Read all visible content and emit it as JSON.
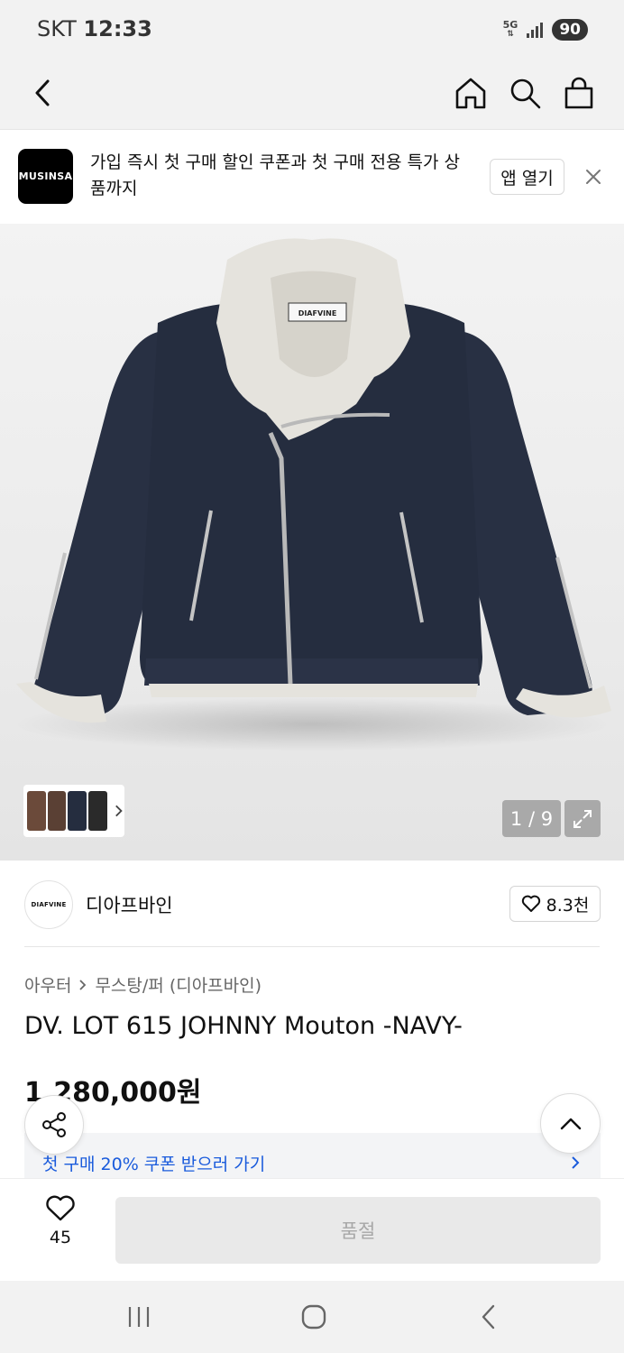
{
  "status_bar": {
    "carrier": "SKT",
    "time": "12:33",
    "network": "5G",
    "battery": "90"
  },
  "promo": {
    "logo": "MUSINSA",
    "text": "가입 즉시 첫 구매 할인 쿠폰과 첫 구매 전용 특가 상품까지",
    "open_label": "앱 열기"
  },
  "gallery": {
    "counter": "1 / 9",
    "current": 1,
    "total": 9,
    "collar_tag": "DIAFVINE"
  },
  "brand": {
    "logo": "DIAFVINE",
    "name": "디아프바인",
    "likes": "8.3천"
  },
  "breadcrumb": {
    "category": "아우터",
    "sub_category": "무스탕/퍼 (디아프바인)"
  },
  "product": {
    "title": "DV. LOT 615 JOHNNY Mouton -NAVY-",
    "price": "1,280,000원"
  },
  "coupon": {
    "text": "첫 구매 20% 쿠폰 받으러 가기"
  },
  "bottom_bar": {
    "like_count": "45",
    "buy_label": "품절"
  },
  "colors": {
    "accent_blue": "#1a5bdc",
    "jacket_navy": "#252d3f",
    "fur": "#e4e2dc"
  }
}
